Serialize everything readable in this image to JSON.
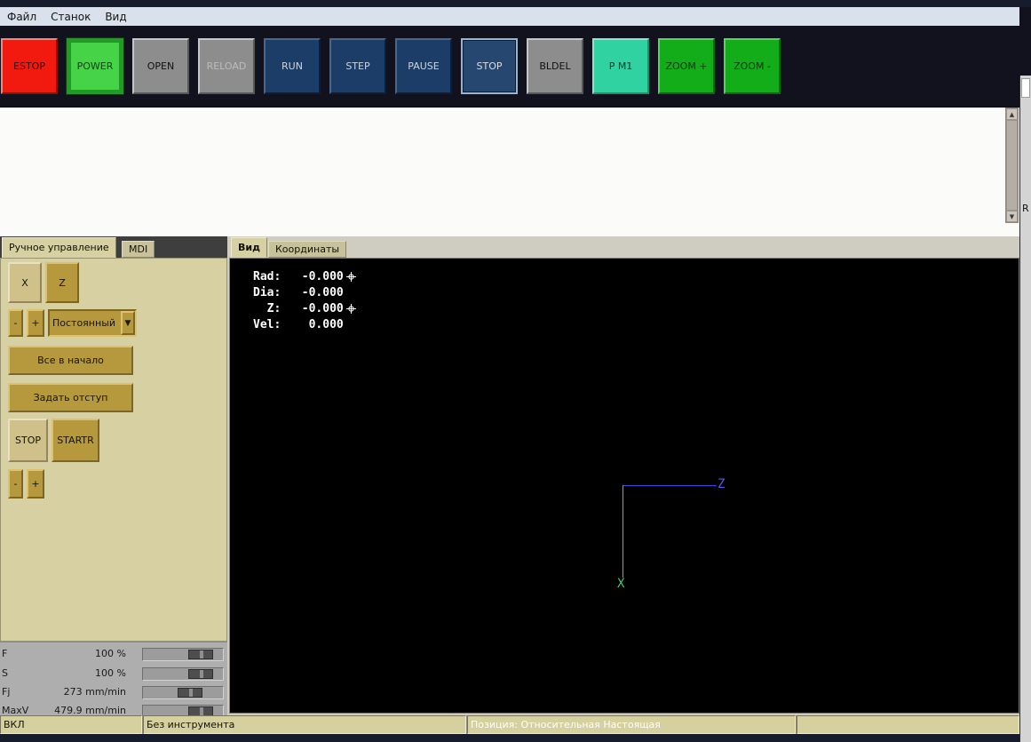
{
  "menu": {
    "items": [
      {
        "label": "Файл"
      },
      {
        "label": "Станок"
      },
      {
        "label": "Вид"
      }
    ]
  },
  "toolbar": {
    "buttons": [
      {
        "label": "ESTOP"
      },
      {
        "label": "POWER"
      },
      {
        "label": "OPEN"
      },
      {
        "label": "RELOAD"
      },
      {
        "label": "RUN"
      },
      {
        "label": "STEP"
      },
      {
        "label": "PAUSE"
      },
      {
        "label": "STOP"
      },
      {
        "label": "BLDEL"
      },
      {
        "label": "P M1"
      },
      {
        "label": "ZOOM +"
      },
      {
        "label": "ZOOM -"
      }
    ]
  },
  "manual_panel": {
    "tabs": {
      "manual": "Ручное управление",
      "mdi": "MDI"
    },
    "axis_x": "X",
    "axis_z": "Z",
    "jog_minus": "-",
    "jog_plus": "+",
    "jog_mode": "Постоянный",
    "home_all": "Все в начало",
    "touch_off": "Задать отступ",
    "spindle_stop": "STOP",
    "spindle_start": "STARTR",
    "spindle_minus": "-",
    "spindle_plus": "+"
  },
  "overrides": {
    "rows": [
      {
        "label": "F",
        "value": "100 %",
        "handle_left": "57%"
      },
      {
        "label": "S",
        "value": "100 %",
        "handle_left": "57%"
      },
      {
        "label": "Fj",
        "value": "273 mm/min",
        "handle_left": "43%"
      },
      {
        "label": "MaxV",
        "value": "479.9 mm/min",
        "handle_left": "57%"
      }
    ]
  },
  "preview": {
    "tabs": {
      "view": "Вид",
      "coords": "Координаты"
    },
    "dro": [
      {
        "label": "Rad:",
        "value": "-0.000",
        "unhomed": true
      },
      {
        "label": "Dia:",
        "value": "-0.000",
        "unhomed": false
      },
      {
        "label": "Z:",
        "value": "-0.000",
        "unhomed": true
      },
      {
        "label": "Vel:",
        "value": "0.000",
        "unhomed": false
      }
    ],
    "axes": {
      "z": "Z",
      "x": "X",
      "z_color": "#4646d8",
      "x_color": "#49c86d"
    }
  },
  "status_bar": {
    "machine_state": "ВКЛ",
    "tool": "Без инструмента",
    "position": "Позиция: Относительная Настоящая"
  },
  "right_strip": {
    "label": "R"
  },
  "colors": {
    "estop_red": "#f21a0e",
    "power_green": "#46d348",
    "navy_button": "#1c3d67",
    "gray_button": "#8d8d8d",
    "teal_button": "#30d2a2",
    "zoom_green": "#12ad18",
    "panel_tan": "#d6d0a3",
    "panel_button": "#b6993d",
    "canvas_black": "#000000",
    "status_tan": "#d6cf9e"
  }
}
